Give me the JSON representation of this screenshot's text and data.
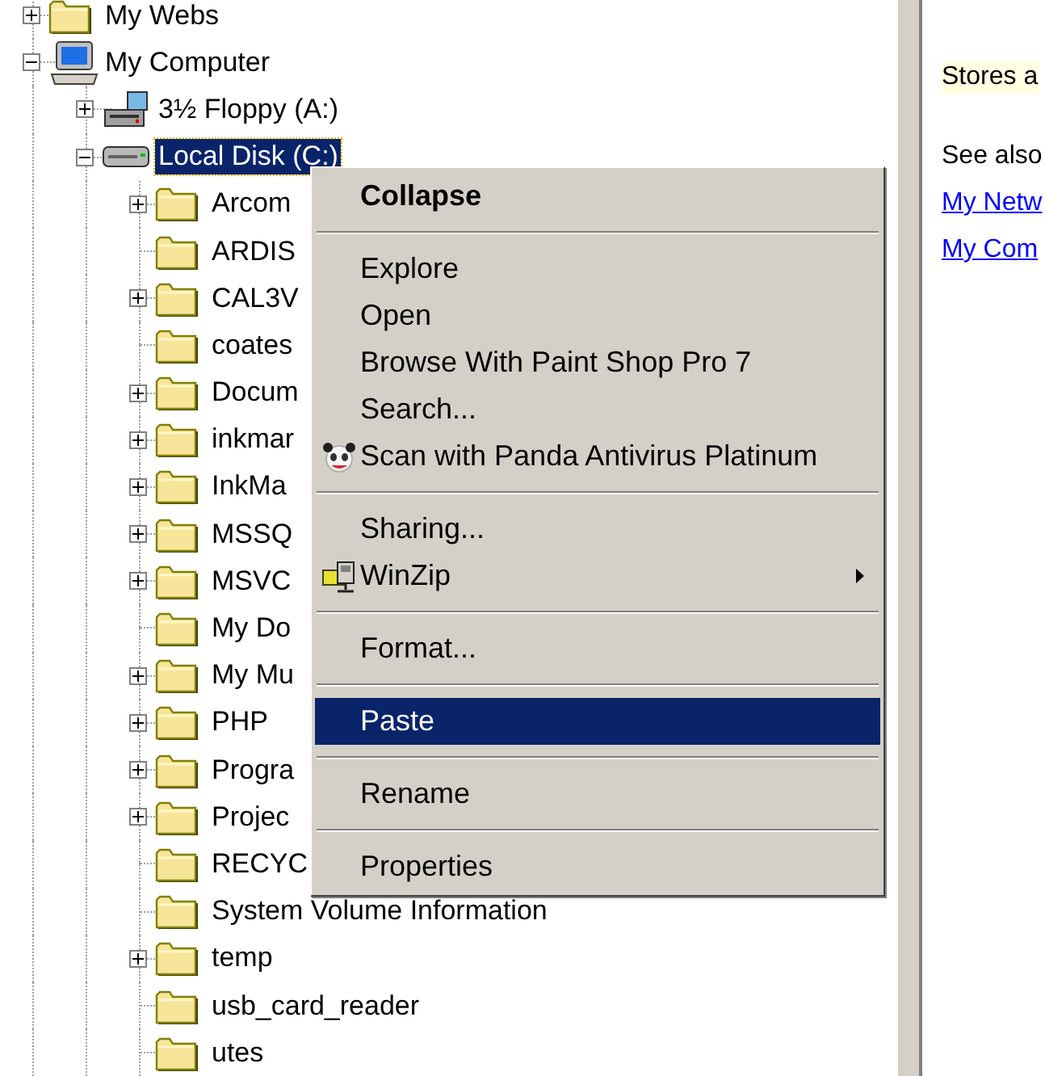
{
  "tree": [
    {
      "label": "My Webs",
      "kind": "folder",
      "has_children": true,
      "expanded": false,
      "selected": false
    },
    {
      "label": "My Computer",
      "kind": "computer",
      "has_children": true,
      "expanded": true,
      "selected": false,
      "children": [
        {
          "label": "3½ Floppy (A:)",
          "kind": "floppy",
          "has_children": true,
          "expanded": false,
          "selected": false
        },
        {
          "label": "Local Disk (C:)",
          "kind": "disk",
          "has_children": true,
          "expanded": true,
          "selected": true,
          "children": [
            {
              "label": "Arcom",
              "kind": "folder",
              "has_children": true,
              "expanded": false,
              "selected": false
            },
            {
              "label": "ARDIS",
              "kind": "folder",
              "has_children": false,
              "selected": false
            },
            {
              "label": "CAL3V",
              "kind": "folder",
              "has_children": true,
              "expanded": false,
              "selected": false
            },
            {
              "label": "coates",
              "kind": "folder",
              "has_children": false,
              "selected": false
            },
            {
              "label": "Docum",
              "kind": "folder",
              "has_children": true,
              "expanded": false,
              "selected": false
            },
            {
              "label": "inkmar",
              "kind": "folder",
              "has_children": true,
              "expanded": false,
              "selected": false
            },
            {
              "label": "InkMa",
              "kind": "folder",
              "has_children": true,
              "expanded": false,
              "selected": false
            },
            {
              "label": "MSSQ",
              "kind": "folder",
              "has_children": true,
              "expanded": false,
              "selected": false
            },
            {
              "label": "MSVC",
              "kind": "folder",
              "has_children": true,
              "expanded": false,
              "selected": false
            },
            {
              "label": "My Do",
              "kind": "folder",
              "has_children": false,
              "selected": false
            },
            {
              "label": "My Mu",
              "kind": "folder",
              "has_children": true,
              "expanded": false,
              "selected": false
            },
            {
              "label": "PHP",
              "kind": "folder",
              "has_children": true,
              "expanded": false,
              "selected": false
            },
            {
              "label": "Progra",
              "kind": "folder",
              "has_children": true,
              "expanded": false,
              "selected": false
            },
            {
              "label": "Projec",
              "kind": "folder",
              "has_children": true,
              "expanded": false,
              "selected": false
            },
            {
              "label": "RECYC",
              "kind": "folder",
              "has_children": false,
              "selected": false
            },
            {
              "label": "System Volume Information",
              "kind": "folder",
              "has_children": false,
              "selected": false
            },
            {
              "label": "temp",
              "kind": "folder",
              "has_children": true,
              "expanded": false,
              "selected": false
            },
            {
              "label": "usb_card_reader",
              "kind": "folder",
              "has_children": false,
              "selected": false
            },
            {
              "label": "utes",
              "kind": "folder",
              "has_children": false,
              "selected": false
            }
          ]
        }
      ]
    }
  ],
  "context_menu": [
    {
      "kind": "command",
      "label": "Collapse",
      "default": true,
      "selected": false,
      "submenu": false
    },
    {
      "kind": "separator"
    },
    {
      "kind": "command",
      "label": "Explore",
      "default": false,
      "selected": false,
      "submenu": false
    },
    {
      "kind": "command",
      "label": "Open",
      "default": false,
      "selected": false,
      "submenu": false
    },
    {
      "kind": "command",
      "label": "Browse With Paint Shop Pro 7",
      "default": false,
      "selected": false,
      "submenu": false
    },
    {
      "kind": "command",
      "label": "Search...",
      "default": false,
      "selected": false,
      "submenu": false
    },
    {
      "kind": "scan",
      "label": "Scan with Panda Antivirus Platinum",
      "default": false,
      "selected": false,
      "submenu": false
    },
    {
      "kind": "separator"
    },
    {
      "kind": "command",
      "label": "Sharing...",
      "default": false,
      "selected": false,
      "submenu": false
    },
    {
      "kind": "archive",
      "label": "WinZip",
      "default": false,
      "selected": false,
      "submenu": true
    },
    {
      "kind": "separator"
    },
    {
      "kind": "command",
      "label": "Format...",
      "default": false,
      "selected": false,
      "submenu": false
    },
    {
      "kind": "separator"
    },
    {
      "kind": "command",
      "label": "Paste",
      "default": false,
      "selected": true,
      "submenu": false
    },
    {
      "kind": "separator"
    },
    {
      "kind": "command",
      "label": "Rename",
      "default": false,
      "selected": false,
      "submenu": false
    },
    {
      "kind": "separator"
    },
    {
      "kind": "command",
      "label": "Properties",
      "default": false,
      "selected": false,
      "submenu": false
    }
  ],
  "info_panel": {
    "description": "Stores a",
    "see_also_heading": "See also",
    "links": [
      "My Netw",
      "My Com"
    ]
  }
}
